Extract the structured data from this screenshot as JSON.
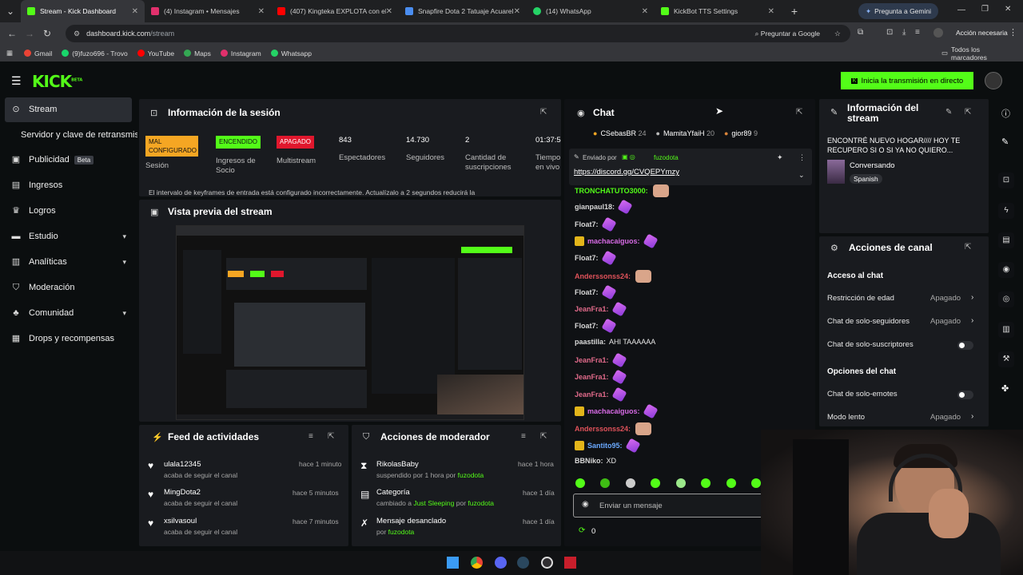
{
  "browser": {
    "tabs": [
      {
        "title": "Stream - Kick Dashboard",
        "color": "#53fc18",
        "active": true
      },
      {
        "title": "(4) Instagram • Mensajes",
        "color": "#e1306c"
      },
      {
        "title": "(407) Kingteka EXPLOTA con el",
        "color": "#ff0000"
      },
      {
        "title": "Snapfire Dota 2 Tatuaje Acuarel",
        "color": "#4a8df0"
      },
      {
        "title": "(14) WhatsApp",
        "color": "#25d366"
      },
      {
        "title": "KickBot TTS Settings",
        "color": "#53fc18"
      }
    ],
    "gemini_button": "Pregunta a Gemini",
    "url_host": "dashboard.kick.com",
    "url_path": "/stream",
    "ask_google": "Preguntar a Google",
    "action_needed": "Acción necesaria",
    "bookmarks": [
      {
        "label": "Gmail",
        "color": "#ea4335"
      },
      {
        "label": "(9)fuzo696 - Trovo",
        "color": "#19d66b"
      },
      {
        "label": "YouTube",
        "color": "#ff0000"
      },
      {
        "label": "Maps",
        "color": "#34a853"
      },
      {
        "label": "Instagram",
        "color": "#e1306c"
      },
      {
        "label": "Whatsapp",
        "color": "#25d366"
      }
    ],
    "all_bookmarks": "Todos los marcadores"
  },
  "header": {
    "logo": "KICK",
    "logo_sup": "BETA",
    "go_live": "Inicia la transmisión en directo"
  },
  "sidebar": {
    "items": [
      {
        "label": "Stream"
      },
      {
        "label": "Servidor y clave de retransmisión"
      },
      {
        "label": "Publicidad",
        "badge": "Beta"
      },
      {
        "label": "Ingresos"
      },
      {
        "label": "Logros"
      },
      {
        "label": "Estudio"
      },
      {
        "label": "Analíticas"
      },
      {
        "label": "Moderación"
      },
      {
        "label": "Comunidad"
      },
      {
        "label": "Drops y recompensas"
      }
    ]
  },
  "session": {
    "title": "Información de la sesión",
    "stats": [
      {
        "badge": "MAL CONFIGURADO",
        "label": "Sesión",
        "badge_color": "#f5a623"
      },
      {
        "badge": "ENCENDIDO",
        "label": "Ingresos de Socio",
        "badge_color": "#53fc18"
      },
      {
        "badge": "APAGADO",
        "label": "Multistream",
        "badge_color": "#e0172d"
      },
      {
        "value": "843",
        "label": "Espectadores"
      },
      {
        "value": "14.730",
        "label": "Seguidores"
      },
      {
        "value": "2",
        "label": "Cantidad de suscripciones"
      },
      {
        "value": "01:37:5",
        "label": "Tiempo en vivo"
      }
    ],
    "warning": "El intervalo de keyframes de entrada está configurado incorrectamente. Actualízalo a 2 segundos reducirá la"
  },
  "preview": {
    "title": "Vista previa del stream"
  },
  "activity": {
    "title": "Feed de actividades",
    "items": [
      {
        "user": "ulala12345",
        "action": "acaba de seguir el canal",
        "time": "hace 1 minuto"
      },
      {
        "user": "MingDota2",
        "action": "acaba de seguir el canal",
        "time": "hace 5 minutos"
      },
      {
        "user": "xsilvasoul",
        "action": "acaba de seguir el canal",
        "time": "hace 7 minutos"
      }
    ]
  },
  "modactions": {
    "title": "Acciones de moderador",
    "items": [
      {
        "title": "RikolasBaby",
        "detail": "suspendido por 1 hora por",
        "by": "fuzodota",
        "time": "hace 1 hora"
      },
      {
        "title": "Categoría",
        "detail": "cambiado a",
        "extra": "Just Sleeping",
        "detail2": "por",
        "by": "fuzodota",
        "time": "hace 1 día"
      },
      {
        "title": "Mensaje desanclado",
        "detail": "por",
        "by": "fuzodota",
        "time": "hace 1 día"
      }
    ]
  },
  "chat": {
    "title": "Chat",
    "top_gifters": [
      {
        "name": "CSebasBR",
        "count": "24"
      },
      {
        "name": "MamitaYfaiH",
        "count": "20"
      },
      {
        "name": "gior89",
        "count": "9"
      }
    ],
    "pinned_by_label": "Enviado por",
    "pinned_user": "fuzodota",
    "pinned_link": "https://discord.gg/CVQEPYmzy",
    "messages": [
      {
        "user": "TRONCHATUTO3000:",
        "color": "#53fc18",
        "text": "",
        "emote": "face"
      },
      {
        "user": "gianpaul18:",
        "color": "#d8d8d8",
        "text": "",
        "emote": "pen"
      },
      {
        "user": "Float7:",
        "color": "#d8d8d8",
        "text": "",
        "emote": "pen"
      },
      {
        "user": "machacaiguos:",
        "color": "#d86be6",
        "text": "",
        "emote": "pen",
        "badge": true
      },
      {
        "user": "Float7:",
        "color": "#d8d8d8",
        "text": "",
        "emote": "pen"
      },
      {
        "user": "Anderssonss24:",
        "color": "#e0525a",
        "text": "",
        "emote": "face"
      },
      {
        "user": "Float7:",
        "color": "#d8d8d8",
        "text": "",
        "emote": "pen"
      },
      {
        "user": "JeanFra1:",
        "color": "#e06a8a",
        "text": "",
        "emote": "pen"
      },
      {
        "user": "Float7:",
        "color": "#d8d8d8",
        "text": "",
        "emote": "pen"
      },
      {
        "user": "paastilla:",
        "color": "#d8d8d8",
        "text": "AHI TAAAAAA"
      },
      {
        "user": "JeanFra1:",
        "color": "#e06a8a",
        "text": "",
        "emote": "pen"
      },
      {
        "user": "JeanFra1:",
        "color": "#e06a8a",
        "text": "",
        "emote": "pen"
      },
      {
        "user": "JeanFra1:",
        "color": "#e06a8a",
        "text": "",
        "emote": "pen"
      },
      {
        "user": "machacaiguos:",
        "color": "#d86be6",
        "text": "",
        "emote": "pen",
        "badge": true
      },
      {
        "user": "Anderssonss24:",
        "color": "#e0525a",
        "text": "",
        "emote": "face"
      },
      {
        "user": "Santito95:",
        "color": "#6aa9ff",
        "text": "",
        "emote": "pen",
        "badge": true
      },
      {
        "user": "BBNiko:",
        "color": "#d8d8d8",
        "text": "XD"
      }
    ],
    "input_placeholder": "Enviar un mensaje",
    "points": "0"
  },
  "channel_info": {
    "title": "Información del stream",
    "stream_title": "ENCONTRÉ NUEVO HOGAR//// HOY TE RECUPERO SI O SI YA NO QUIERO...",
    "category": "Conversando",
    "language": "Spanish"
  },
  "channel_actions": {
    "title": "Acciones de canal",
    "section1": "Acceso al chat",
    "rows1": [
      {
        "label": "Restricción de edad",
        "value": "Apagado"
      },
      {
        "label": "Chat de solo-seguidores",
        "value": "Apagado"
      },
      {
        "label": "Chat de solo-suscriptores",
        "toggle": true
      }
    ],
    "section2": "Opciones del chat",
    "rows2": [
      {
        "label": "Chat de solo-emotes",
        "toggle": true
      },
      {
        "label": "Modo lento",
        "value": "Apagado"
      }
    ]
  }
}
